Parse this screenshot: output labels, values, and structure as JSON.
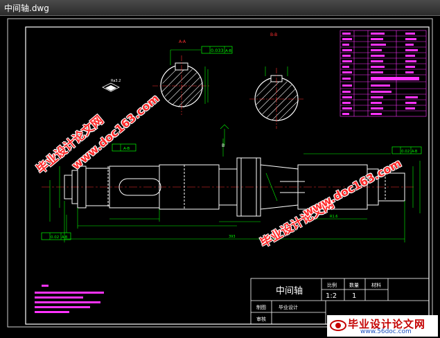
{
  "window": {
    "title": "中间轴.dwg"
  },
  "drawing": {
    "section_a": "A-A",
    "section_b": "B-B",
    "tolerance_top": "0.033",
    "tolerance_top_datum": "A-B",
    "tolerance_left_datum": "A-B",
    "tolerance_bottom": "0.02",
    "tolerance_bottom_datum": "A-B",
    "tolerance_right": "0.02",
    "tolerance_right_datum": "A-B",
    "datum_label": "B",
    "dim_bottom": "393",
    "dim_right_text": "R1.6",
    "ra_value": "Ra3.2"
  },
  "title_block": {
    "part_name": "中间轴",
    "col_scale": "比例",
    "col_qty": "数量",
    "col_material": "材料",
    "scale_value": "1:2",
    "qty_value": "1",
    "drawn_label": "制图",
    "check_label": "审核",
    "school_label": "毕业设计"
  },
  "watermarks": {
    "cn": "毕业设计论文网",
    "url": "www.doc163.com"
  },
  "logo": {
    "text": "毕业设计论文网",
    "url": "www.56doc.com"
  },
  "colors": {
    "background": "#000000",
    "line": "#ffffff",
    "dimension": "#00ff00",
    "center": "#ff3030",
    "table": "#ff00ff",
    "watermark": "#ff2a2a"
  }
}
